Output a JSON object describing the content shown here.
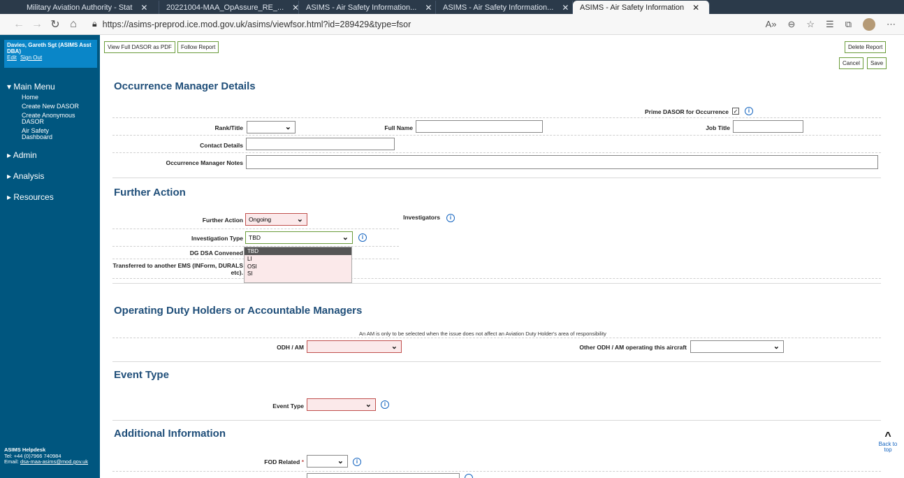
{
  "browser": {
    "tabs": [
      {
        "label": "Military Aviation Authority - Stat"
      },
      {
        "label": "20221004-MAA_OpAssure_RE_..."
      },
      {
        "label": "ASIMS - Air Safety Information..."
      },
      {
        "label": "ASIMS - Air Safety Information..."
      },
      {
        "label": "ASIMS - Air Safety Information",
        "active": true
      }
    ],
    "url": "https://asims-preprod.ice.mod.gov.uk/asims/viewfsor.html?id=289429&type=fsor"
  },
  "sidebar": {
    "user": "Davies, Gareth Sgt (ASIMS Asst DBA)",
    "edit": "Edit",
    "signout": "Sign Out",
    "main_menu": "Main Menu",
    "items": [
      "Home",
      "Create New DASOR",
      "Create Anonymous DASOR",
      "Air Safety Dashboard"
    ],
    "admin": "Admin",
    "analysis": "Analysis",
    "resources": "Resources",
    "helpdesk": {
      "title": "ASIMS Helpdesk",
      "tel": "Tel: +44 (0)7966 740984",
      "email_label": "Email:",
      "email": "dsa-maa-asims@mod.gov.uk"
    }
  },
  "toolbar": {
    "view_pdf": "View Full DASOR as PDF",
    "follow": "Follow Report",
    "delete": "Delete Report",
    "cancel": "Cancel",
    "save": "Save"
  },
  "occurrence_manager": {
    "heading": "Occurrence Manager Details",
    "prime_label": "Prime DASOR for Occurrence",
    "prime_checked": true,
    "rank_label": "Rank/Title",
    "fullname_label": "Full Name",
    "jobtitle_label": "Job Title",
    "contact_label": "Contact Details",
    "notes_label": "Occurrence Manager Notes"
  },
  "further_action": {
    "heading": "Further Action",
    "further_action_label": "Further Action",
    "further_action_value": "Ongoing",
    "investigators_label": "Investigators",
    "investigation_type_label": "Investigation Type",
    "investigation_type_value": "TBD",
    "dg_label": "DG DSA Convened",
    "transferred_label": "Transferred to another EMS (INForm, DURALS etc).",
    "options": [
      "TBD",
      "LI",
      "OSI",
      "SI"
    ]
  },
  "odh": {
    "heading": "Operating Duty Holders or Accountable Managers",
    "note": "An AM is only to be selected when the issue does not affect an Aviation Duty Holder's area of responsibility",
    "odh_label": "ODH / AM",
    "other_label": "Other ODH / AM operating this aircraft"
  },
  "event_type": {
    "heading": "Event Type",
    "label": "Event Type"
  },
  "additional": {
    "heading": "Additional Information",
    "fod_label": "FOD Related"
  },
  "back_to_top": "Back to top"
}
